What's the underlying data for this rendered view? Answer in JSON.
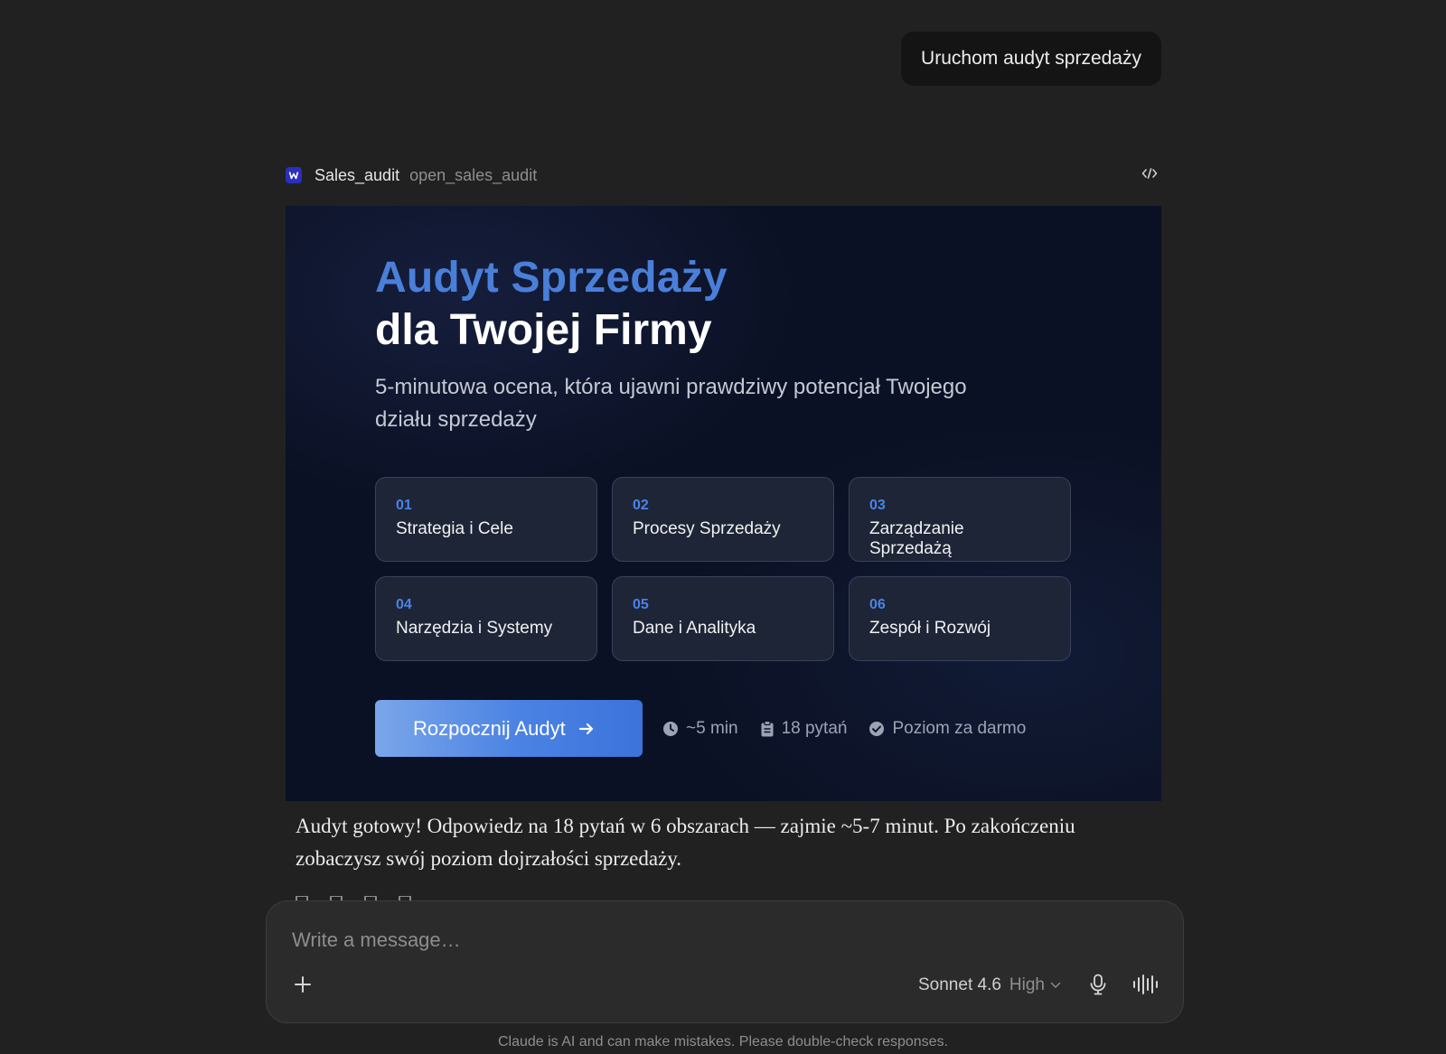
{
  "user_message": "Uruchom audyt sprzedaży",
  "tool": {
    "name": "Sales_audit",
    "function": "open_sales_audit",
    "icon": "sales-audit-app-icon",
    "code_toggle_icon": "code-icon"
  },
  "widget": {
    "title_line1": "Audyt Sprzedaży",
    "title_line2": "dla Twojej Firmy",
    "subtitle": "5-minutowa ocena, która ujawni prawdziwy potencjał Twojego działu sprzedaży",
    "cards": [
      {
        "num": "01",
        "label": "Strategia i Cele"
      },
      {
        "num": "02",
        "label": "Procesy Sprzedaży"
      },
      {
        "num": "03",
        "label": "Zarządzanie Sprzedażą"
      },
      {
        "num": "04",
        "label": "Narzędzia i Systemy"
      },
      {
        "num": "05",
        "label": "Dane i Analityka"
      },
      {
        "num": "06",
        "label": "Zespół i Rozwój"
      }
    ],
    "cta_label": "Rozpocznij Audyt",
    "meta": {
      "duration": "~5 min",
      "questions": "18 pytań",
      "level": "Poziom za darmo"
    },
    "colors": {
      "accent": "#4a7fd9",
      "background": "#0b1124",
      "card_background": "#1d2537"
    }
  },
  "assistant_message": "Audyt gotowy! Odpowiedz na 18 pytań w 6 obszarach — zajmie ~5-7 minut. Po zakończeniu zobaczysz swój poziom dojrzałości sprzedaży.",
  "composer": {
    "placeholder": "Write a message…",
    "model": "Sonnet 4.6",
    "effort": "High"
  },
  "disclaimer": "Claude is AI and can make mistakes. Please double-check responses."
}
